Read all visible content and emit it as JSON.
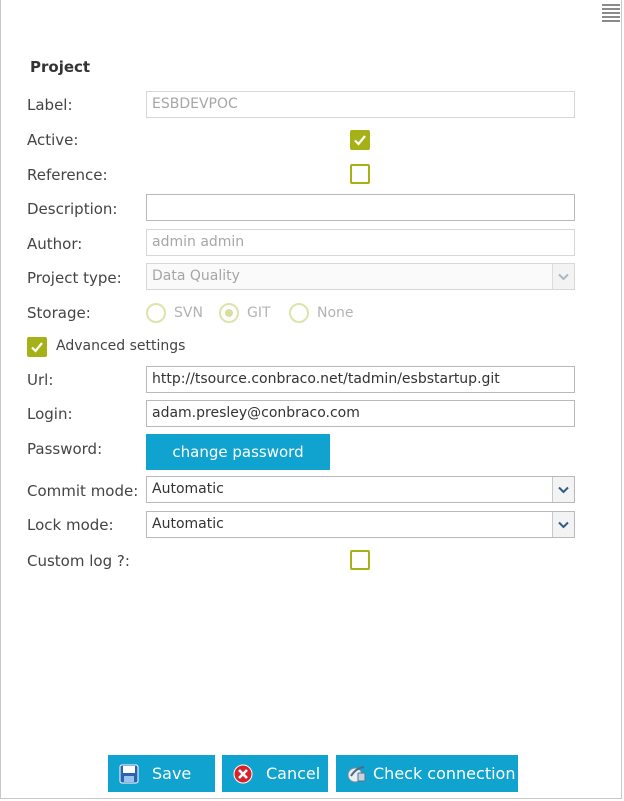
{
  "section": {
    "title": "Project"
  },
  "labels": {
    "label": "Label:",
    "active": "Active:",
    "reference": "Reference:",
    "description": "Description:",
    "author": "Author:",
    "project_type": "Project type:",
    "storage": "Storage:",
    "advanced": "Advanced settings",
    "url": "Url:",
    "login": "Login:",
    "password": "Password:",
    "commit_mode": "Commit mode:",
    "lock_mode": "Lock mode:",
    "custom_log": "Custom log ?:"
  },
  "values": {
    "label": "ESBDEVPOC",
    "active": true,
    "reference": false,
    "description": "",
    "author": "admin admin",
    "project_type": "Data Quality",
    "advanced": true,
    "url": "http://tsource.conbraco.net/tadmin/esbstartup.git",
    "login": "adam.presley@conbraco.com",
    "commit_mode": "Automatic",
    "lock_mode": "Automatic",
    "custom_log": false
  },
  "storage": {
    "options": [
      "SVN",
      "GIT",
      "None"
    ],
    "selected": "GIT"
  },
  "buttons": {
    "change_password": "change password",
    "save": "Save",
    "cancel": "Cancel",
    "check_connection": "Check connection"
  },
  "colors": {
    "accent": "#a5b117",
    "button": "#10a3cf"
  },
  "icons": {
    "menu": "hamburger-menu-icon",
    "save": "floppy-disk-icon",
    "cancel": "cancel-x-icon",
    "check": "connection-icon"
  }
}
